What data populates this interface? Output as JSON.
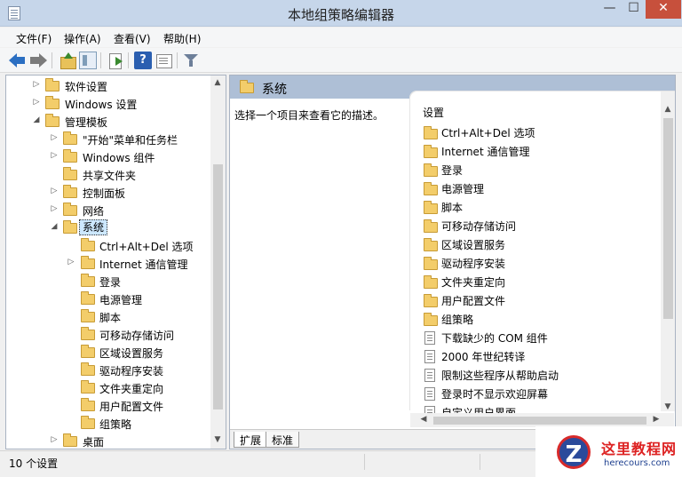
{
  "window": {
    "title": "本地组策略编辑器",
    "controls": {
      "minimize": "—",
      "maximize": "☐",
      "close": "✕"
    }
  },
  "menu": [
    {
      "label": "文件(F)"
    },
    {
      "label": "操作(A)"
    },
    {
      "label": "查看(V)"
    },
    {
      "label": "帮助(H)"
    }
  ],
  "toolbar": {
    "icons": [
      "back-arrow-icon",
      "forward-arrow-icon",
      "up-folder-icon",
      "show-tree-icon",
      "export-list-icon",
      "help-icon",
      "properties-icon",
      "filter-icon"
    ],
    "help_glyph": "?"
  },
  "tree": {
    "items": [
      {
        "label": "软件设置",
        "expander": "▷"
      },
      {
        "label": "Windows 设置",
        "expander": "▷"
      },
      {
        "label": "管理模板",
        "expander": "◢"
      },
      {
        "label": "\"开始\"菜单和任务栏",
        "expander": "▷"
      },
      {
        "label": "Windows 组件",
        "expander": "▷"
      },
      {
        "label": "共享文件夹",
        "expander": ""
      },
      {
        "label": "控制面板",
        "expander": "▷"
      },
      {
        "label": "网络",
        "expander": "▷"
      },
      {
        "label": "系统",
        "expander": "◢",
        "selected": true
      },
      {
        "label": "Ctrl+Alt+Del 选项",
        "expander": ""
      },
      {
        "label": "Internet 通信管理",
        "expander": "▷"
      },
      {
        "label": "登录",
        "expander": ""
      },
      {
        "label": "电源管理",
        "expander": ""
      },
      {
        "label": "脚本",
        "expander": ""
      },
      {
        "label": "可移动存储访问",
        "expander": ""
      },
      {
        "label": "区域设置服务",
        "expander": ""
      },
      {
        "label": "驱动程序安装",
        "expander": ""
      },
      {
        "label": "文件夹重定向",
        "expander": ""
      },
      {
        "label": "用户配置文件",
        "expander": ""
      },
      {
        "label": "组策略",
        "expander": ""
      },
      {
        "label": "桌面",
        "expander": "▷"
      }
    ]
  },
  "details": {
    "header": "系统",
    "description": "选择一个项目来查看它的描述。",
    "column_header": "设置",
    "items": [
      {
        "label": "Ctrl+Alt+Del 选项",
        "icon": "folder"
      },
      {
        "label": "Internet 通信管理",
        "icon": "folder"
      },
      {
        "label": "登录",
        "icon": "folder"
      },
      {
        "label": "电源管理",
        "icon": "folder"
      },
      {
        "label": "脚本",
        "icon": "folder"
      },
      {
        "label": "可移动存储访问",
        "icon": "folder"
      },
      {
        "label": "区域设置服务",
        "icon": "folder"
      },
      {
        "label": "驱动程序安装",
        "icon": "folder"
      },
      {
        "label": "文件夹重定向",
        "icon": "folder"
      },
      {
        "label": "用户配置文件",
        "icon": "folder"
      },
      {
        "label": "组策略",
        "icon": "folder"
      },
      {
        "label": "下载缺少的 COM 组件",
        "icon": "setting"
      },
      {
        "label": "2000 年世纪转译",
        "icon": "setting"
      },
      {
        "label": "限制这些程序从帮助启动",
        "icon": "setting"
      },
      {
        "label": "登录时不显示欢迎屏幕",
        "icon": "setting"
      },
      {
        "label": "自定义用户界面",
        "icon": "setting"
      }
    ],
    "tabs": [
      {
        "label": "扩展",
        "active": true
      },
      {
        "label": "标准",
        "active": false
      }
    ]
  },
  "scroll_arrows": {
    "up": "▲",
    "down": "▼",
    "left": "◀",
    "right": "▶"
  },
  "status": {
    "text": "10 个设置"
  },
  "watermark": {
    "logo": "Z",
    "title": "这里教程网",
    "url": "herecours.com"
  },
  "colors": {
    "title_bar": "#c6d6ea",
    "pane_header": "#aebfd6",
    "folder": "#f3cd6a",
    "close_button": "#c7503c"
  }
}
